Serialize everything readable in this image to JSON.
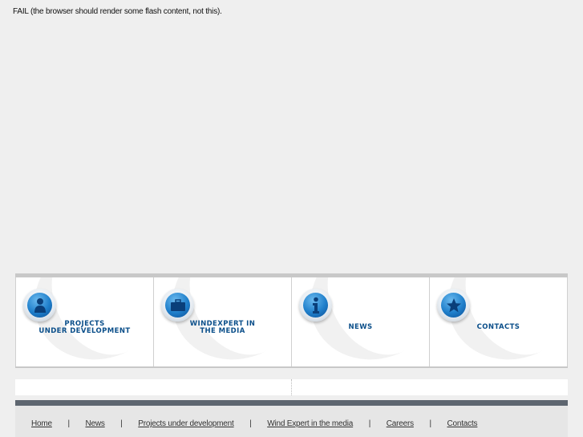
{
  "flash_message": "FAIL (the browser should render some flash content, not this).",
  "tiles": [
    {
      "line1": "PROJECTS",
      "line2": "UNDER DEVELOPMENT",
      "icon": "person-icon"
    },
    {
      "line1": "WINDEXPERT IN",
      "line2": "THE MEDIA",
      "icon": "briefcase-icon"
    },
    {
      "line1": "NEWS",
      "line2": "",
      "icon": "info-icon"
    },
    {
      "line1": "CONTACTS",
      "line2": "",
      "icon": "star-icon"
    }
  ],
  "footer": {
    "links": [
      "Home",
      "News",
      "Projects under development",
      "Wind Expert in the media",
      "Careers",
      "Contacts"
    ],
    "separator": "|"
  },
  "colors": {
    "tile_label": "#0b4f8a",
    "icon_blue": "#1f7fcb",
    "footer_bar": "#5e6670",
    "background": "#efefef"
  }
}
